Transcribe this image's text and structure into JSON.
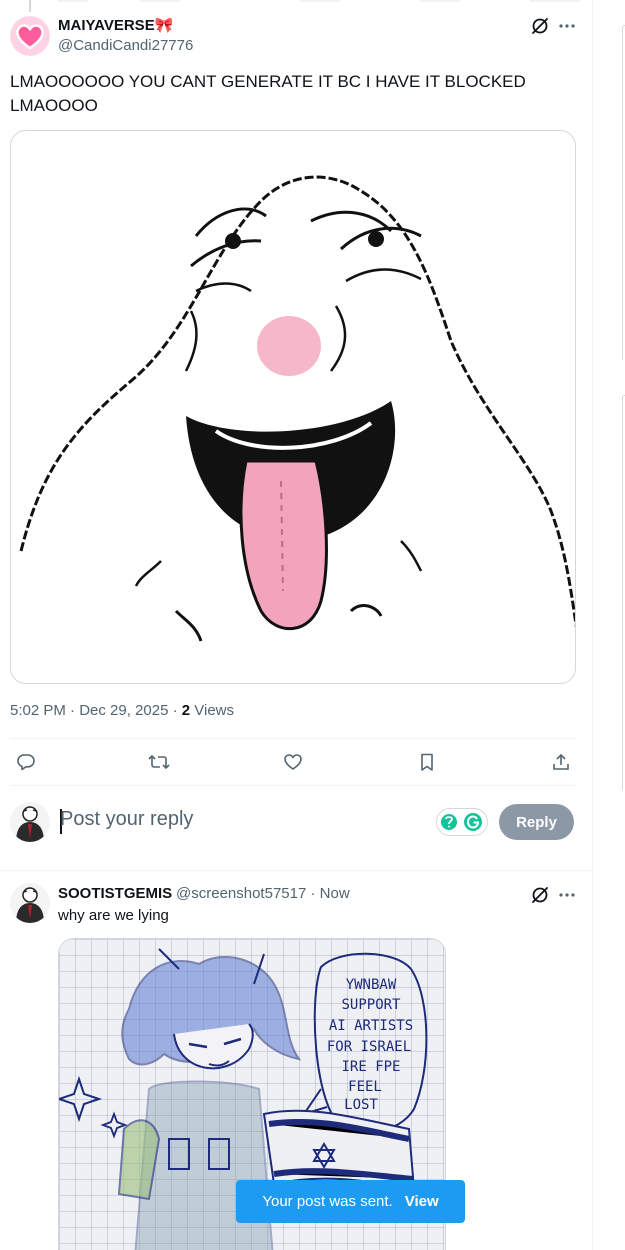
{
  "main_post": {
    "display_name": "MAIYAVERSE🎀",
    "handle": "@CandiCandi27776",
    "text": "LMAOOOOOO YOU CANT GENERATE IT BC I HAVE IT BLOCKED LMAOOOO",
    "time": "5:02 PM · Dec 29, 2025 · ",
    "views_count": "2",
    "views_label": " Views"
  },
  "icons": {
    "grok": "grok-icon",
    "more": "more-icon",
    "reply": "reply-icon",
    "repost": "repost-icon",
    "like": "like-icon",
    "bookmark": "bookmark-icon",
    "share": "share-icon"
  },
  "composer": {
    "placeholder": "Post your reply",
    "reply_button": "Reply"
  },
  "reply_post": {
    "display_name": "SOOTISTGEMIS",
    "handle": "@screenshot57517",
    "separator": " · ",
    "time": "Now",
    "text": "why are we lying"
  },
  "drawing_speech_lines": [
    "YWNBAW",
    "SUPPORT",
    "AI ARTISTS",
    "FOR ISRAEL",
    "IRE FPE",
    "FEEL",
    "LOST"
  ],
  "toast": {
    "message": "Your post was sent.",
    "action": "View"
  },
  "colors": {
    "accent": "#1d9bf0",
    "text": "#0f1419",
    "secondary": "#536471",
    "reply_disabled": "#8b98a5"
  }
}
